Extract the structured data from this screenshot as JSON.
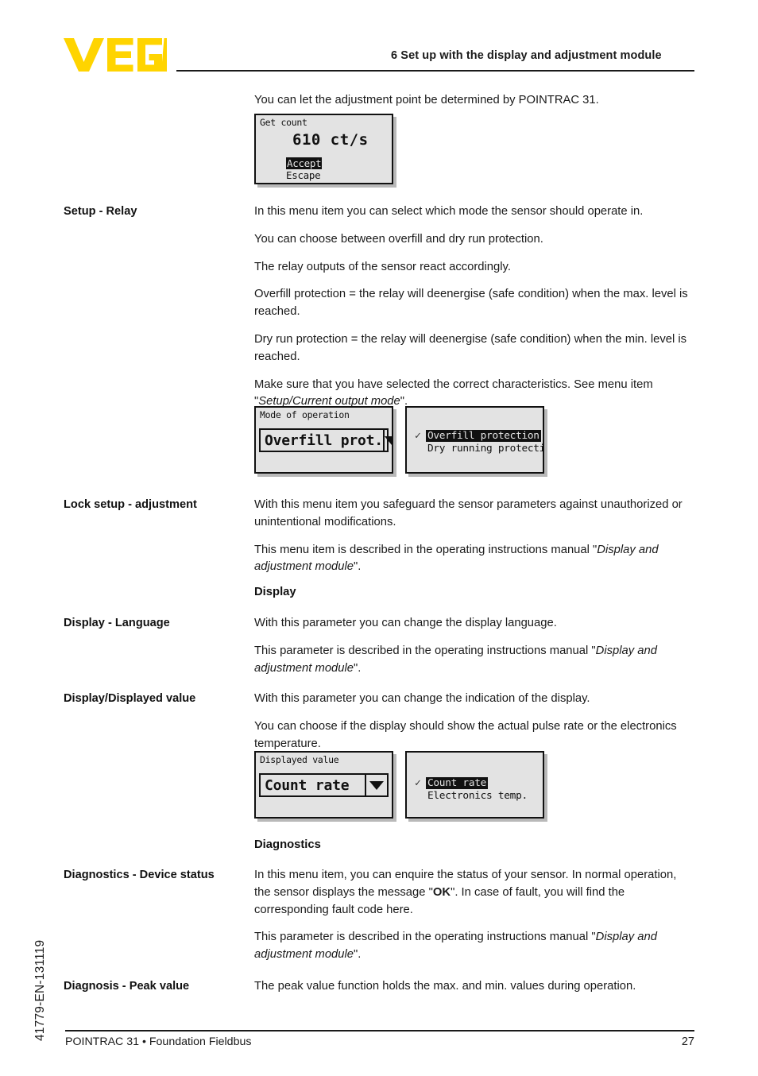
{
  "header": {
    "logo_text": "VEGA",
    "logo_color": "#FFD400",
    "chapter_title": "6 Set up with the display and adjustment module"
  },
  "intro": {
    "text": "You can let the adjustment point be determined by POINTRAC 31."
  },
  "displays": {
    "get_count": {
      "title": "Get count",
      "value": "610 ct/s",
      "button_accept": "Accept",
      "button_escape": "Escape"
    },
    "mode_of_operation": {
      "title": "Mode of operation",
      "selected_value": "Overfill prot.",
      "dropdown_icon": "chevron-down-icon"
    },
    "mode_list": {
      "items": [
        {
          "label": "Overfill protection",
          "checked": true,
          "selected": true
        },
        {
          "label": "Dry running protection",
          "checked": false,
          "selected": false
        }
      ],
      "check_glyph": "✓"
    },
    "displayed_value": {
      "title": "Displayed value",
      "selected_value": "Count rate",
      "dropdown_icon": "chevron-down-icon"
    },
    "displayed_value_list": {
      "items": [
        {
          "label": "Count rate",
          "checked": true,
          "selected": true
        },
        {
          "label": "Electronics temp.",
          "checked": false,
          "selected": false
        }
      ],
      "check_glyph": "✓"
    }
  },
  "sections": {
    "setup_relay": {
      "label": "Setup - Relay",
      "p1": "In this menu item you can select which mode the sensor should operate in.",
      "p2": "You can choose between overfill and dry run protection.",
      "p3": "The relay outputs of the sensor react accordingly.",
      "p4": "Overfill protection = the relay will deenergise (safe condition) when the max. level is reached.",
      "p5": "Dry run protection = the relay will deenergise (safe condition) when the min. level is reached.",
      "p6_before": "Make sure that you have selected the correct characteristics. See menu item \"",
      "p6_italic": "Setup/Current output mode",
      "p6_after": "\"."
    },
    "lock_setup": {
      "label": "Lock setup - adjustment",
      "p1": "With this menu item you safeguard the sensor parameters against unauthorized or unintentional modifications.",
      "p2_before": "This menu item is described in the operating instructions manual \"",
      "p2_italic": "Display and adjustment module",
      "p2_after": "\"."
    },
    "display_heading": "Display",
    "display_language": {
      "label": "Display - Language",
      "p1": "With this parameter you can change the display language.",
      "p2_before": "This parameter is described in the operating instructions manual \"",
      "p2_italic": "Display and adjustment module",
      "p2_after": "\"."
    },
    "displayed_value": {
      "label": "Display/Displayed value",
      "p1": "With this parameter you can change the indication of the display.",
      "p2": "You can choose if the display should show the actual pulse rate or the electronics temperature."
    },
    "diagnostics_heading": "Diagnostics",
    "device_status": {
      "label": "Diagnostics - Device status",
      "p1_before": "In this menu item, you can enquire the status of your sensor. In normal operation, the sensor displays the message \"",
      "p1_bold": "OK",
      "p1_after": "\". In case of fault, you will find the corresponding fault code here.",
      "p2_before": "This parameter is described in the operating instructions manual \"",
      "p2_italic": "Display and adjustment module",
      "p2_after": "\"."
    },
    "peak_value": {
      "label": "Diagnosis - Peak value",
      "p1": "The peak value function holds the max. and min. values during operation."
    }
  },
  "side_code": "41779-EN-131119",
  "footer": {
    "left": "POINTRAC 31 • Foundation Fieldbus",
    "page_number": "27"
  }
}
